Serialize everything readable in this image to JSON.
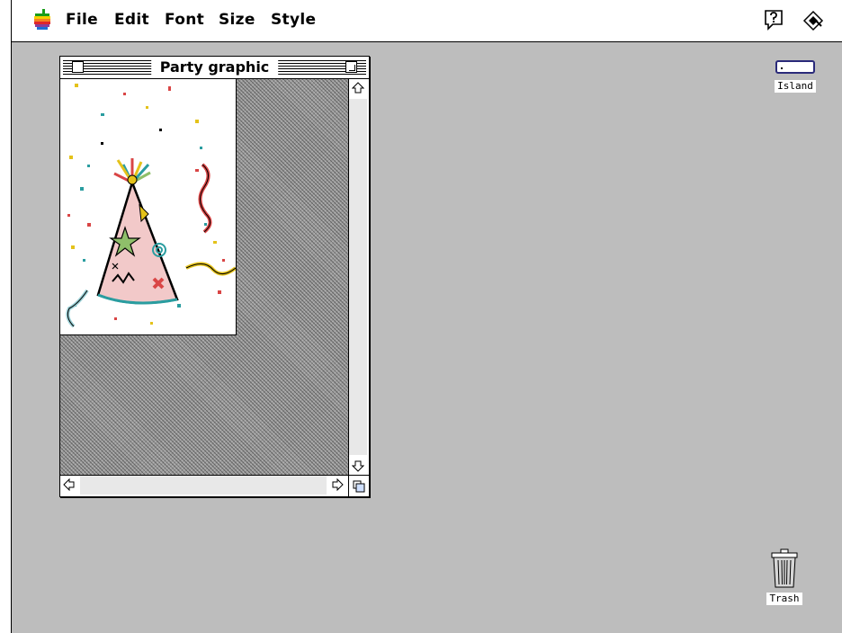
{
  "menubar": {
    "items": [
      {
        "label": "File"
      },
      {
        "label": "Edit"
      },
      {
        "label": "Font"
      },
      {
        "label": "Size"
      },
      {
        "label": "Style"
      }
    ],
    "apple_icon": "apple-menu-icon",
    "help_icon": "balloon-help-icon",
    "app_icon": "application-menu-icon"
  },
  "window": {
    "title": "Party graphic",
    "picture": "party-hat-with-confetti"
  },
  "desktop": {
    "disk_label": "Island",
    "trash_label": "Trash"
  },
  "colors": {
    "desktop": "#bdbdbd",
    "menubar": "#ffffff",
    "hat_fill": "#f2c9c9"
  }
}
